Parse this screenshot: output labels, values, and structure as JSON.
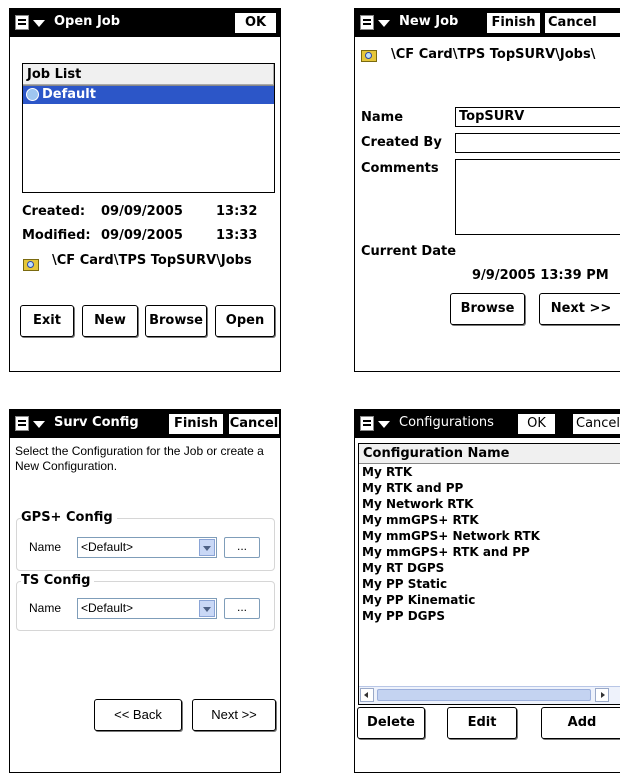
{
  "open_job": {
    "title": "Open Job",
    "ok_label": "OK",
    "list_header": "Job List",
    "jobs": [
      "Default"
    ],
    "created_label": "Created:",
    "created_date": "09/09/2005",
    "created_time": "13:32",
    "modified_label": "Modified:",
    "modified_date": "09/09/2005",
    "modified_time": "13:33",
    "path": "\\CF Card\\TPS TopSURV\\Jobs",
    "buttons": {
      "exit": "Exit",
      "new": "New",
      "browse": "Browse",
      "open": "Open"
    }
  },
  "new_job": {
    "title": "New Job",
    "finish_label": "Finish",
    "cancel_label": "Cancel",
    "path": "\\CF Card\\TPS TopSURV\\Jobs\\",
    "name_label": "Name",
    "name_value": "TopSURV",
    "created_by_label": "Created By",
    "created_by_value": "",
    "comments_label": "Comments",
    "current_date_label": "Current Date",
    "current_date_value": "9/9/2005 13:39 PM",
    "browse_label": "Browse",
    "next_label": "Next >>"
  },
  "surv_config": {
    "title": "Surv Config",
    "finish_label": "Finish",
    "cancel_label": "Cancel",
    "instruction": "Select the Configuration for the Job or create a New Configuration.",
    "gps_group": "GPS+ Config",
    "gps_name_label": "Name",
    "gps_value": "<Default>",
    "ts_group": "TS Config",
    "ts_name_label": "Name",
    "ts_value": "<Default>",
    "ellipsis": "...",
    "back_label": "<< Back",
    "next_label": "Next >>"
  },
  "configurations": {
    "title": "Configurations",
    "ok_label": "OK",
    "cancel_label": "Cancel",
    "header": "Configuration Name",
    "items": [
      "My RTK",
      "My RTK and PP",
      "My Network RTK",
      "My mmGPS+ RTK",
      "My mmGPS+ Network RTK",
      "My mmGPS+ RTK and PP",
      "My RT DGPS",
      "My PP Static",
      "My PP Kinematic",
      "My PP DGPS"
    ],
    "delete_label": "Delete",
    "edit_label": "Edit",
    "add_label": "Add"
  }
}
